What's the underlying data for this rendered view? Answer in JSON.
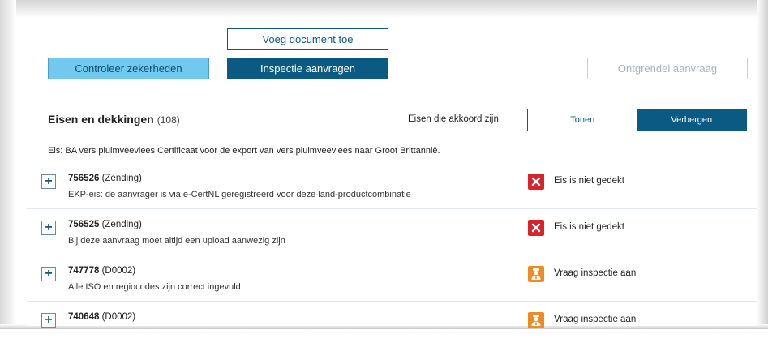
{
  "buttons": {
    "add_document": "Voeg document toe",
    "check_certainties": "Controleer zekerheden",
    "request_inspection": "Inspectie aanvragen",
    "unlock_request": "Ontgrendel aanvraag"
  },
  "section": {
    "title": "Eisen en dekkingen",
    "count": "(108)",
    "filter_label": "Eisen die akkoord zijn",
    "toggle_show": "Tonen",
    "toggle_hide": "Verbergen",
    "toggle_selected": "Verbergen"
  },
  "requirement_description": "Eis: BA vers pluimveevlees Certificaat voor de export van vers pluimveevlees naar Groot Brittannië.",
  "rows": [
    {
      "id": "756526",
      "type": "(Zending)",
      "description": "EKP-eis: de aanvrager is via e-CertNL geregistreerd voor deze land-productcombinatie",
      "status_icon": "close-icon",
      "status": "Eis is niet gedekt"
    },
    {
      "id": "756525",
      "type": "(Zending)",
      "description": "Bij deze aanvraag moet altijd een upload aanwezig zijn",
      "status_icon": "close-icon",
      "status": "Eis is niet gedekt"
    },
    {
      "id": "747778",
      "type": "(D0002)",
      "description": "Alle ISO en regiocodes zijn correct ingevuld",
      "status_icon": "inspector-icon",
      "status": "Vraag inspectie aan"
    },
    {
      "id": "740648",
      "type": "(D0002)",
      "description": "",
      "status_icon": "inspector-icon",
      "status": "Vraag inspectie aan"
    }
  ],
  "colors": {
    "primary": "#0b5a84",
    "light_blue": "#72c9f0",
    "error_red": "#d8232a",
    "inspection_orange": "#f08b24"
  }
}
